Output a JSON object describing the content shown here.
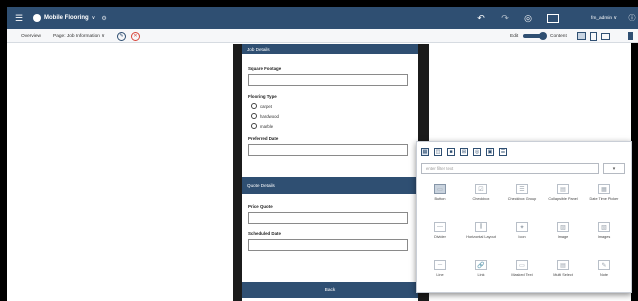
{
  "topbar": {
    "app_title": "Mobile Flooring",
    "app_version": "∨",
    "user": "fm_admin ∨",
    "icons": [
      "menu-icon",
      "app-logo-icon",
      "settings-icon",
      "undo-icon",
      "redo-icon",
      "preview-icon",
      "grid-icon",
      "help-icon"
    ]
  },
  "subbar": {
    "overview": "Overview",
    "page_label": "Page: Job Information ∨",
    "edit_label": "Edit",
    "content_label": "Content",
    "toggle_on": true
  },
  "form": {
    "section1_title": "Job Details",
    "square_footage_label": "Square Footage",
    "flooring_type_label": "Flooring Type",
    "flooring_options": [
      "carpet",
      "hardwood",
      "marble"
    ],
    "preferred_date_label": "Preferred Date",
    "section2_title": "Quote Details",
    "price_quote_label": "Price Quote",
    "scheduled_date_label": "Scheduled Date",
    "back_label": "Back"
  },
  "palette": {
    "filter_placeholder": "enter filter text",
    "filter_button": "▾",
    "items": [
      {
        "label": "Button",
        "icon": "button-icon",
        "selected": true
      },
      {
        "label": "Checkbox",
        "icon": "checkbox-icon",
        "selected": false
      },
      {
        "label": "Checkbox Group",
        "icon": "checkbox-group-icon",
        "selected": false
      },
      {
        "label": "Collapsible Panel",
        "icon": "collapsible-panel-icon",
        "selected": false
      },
      {
        "label": "Date Time Picker",
        "icon": "date-time-picker-icon",
        "selected": false
      },
      {
        "label": "Divider",
        "icon": "divider-icon",
        "selected": false
      },
      {
        "label": "Horizontal Layout",
        "icon": "horizontal-layout-icon",
        "selected": false
      },
      {
        "label": "Icon",
        "icon": "icon-icon",
        "selected": false
      },
      {
        "label": "Image",
        "icon": "image-icon",
        "selected": false
      },
      {
        "label": "Images",
        "icon": "images-icon",
        "selected": false
      },
      {
        "label": "Line",
        "icon": "line-icon",
        "selected": false
      },
      {
        "label": "Link",
        "icon": "link-icon",
        "selected": false
      },
      {
        "label": "Masked Text",
        "icon": "masked-text-icon",
        "selected": false
      },
      {
        "label": "Multi Select",
        "icon": "multi-select-icon",
        "selected": false
      },
      {
        "label": "Note",
        "icon": "note-icon",
        "selected": false
      }
    ]
  },
  "colors": {
    "brand": "#2f4f72",
    "cancel_red": "#d9463b"
  }
}
